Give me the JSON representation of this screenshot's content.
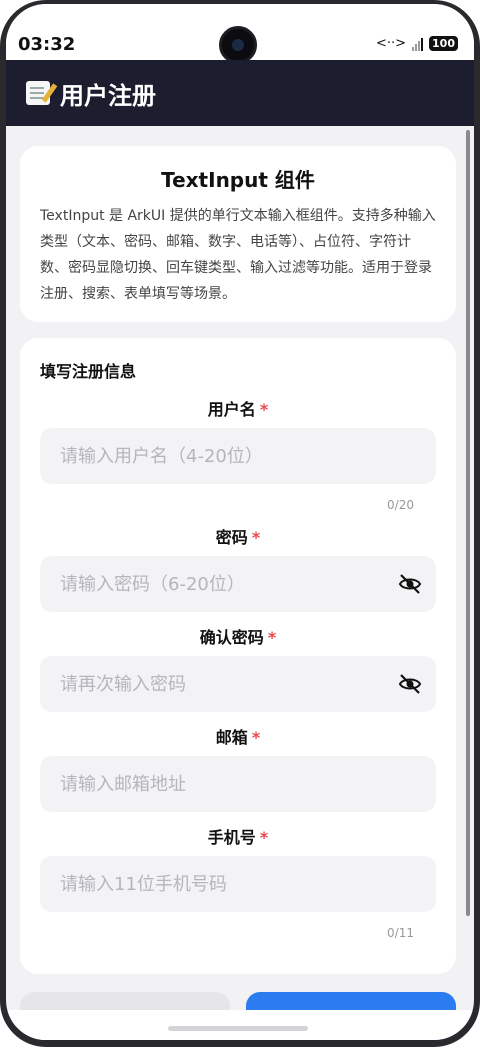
{
  "status_bar": {
    "time": "03:32",
    "battery": "100"
  },
  "header": {
    "icon": "memo-icon",
    "title": "用户注册"
  },
  "intro": {
    "title": "TextInput 组件",
    "description": "TextInput 是 ArkUI 提供的单行文本输入框组件。支持多种输入类型（文本、密码、邮箱、数字、电话等）、占位符、字符计数、密码显隐切换、回车键类型、输入过滤等功能。适用于登录注册、搜索、表单填写等场景。"
  },
  "form": {
    "heading": "填写注册信息",
    "required_mark": "*",
    "fields": {
      "username": {
        "label": "用户名",
        "placeholder": "请输入用户名（4-20位）",
        "counter": "0/20"
      },
      "password": {
        "label": "密码",
        "placeholder": "请输入密码（6-20位）"
      },
      "confirm_password": {
        "label": "确认密码",
        "placeholder": "请再次输入密码"
      },
      "email": {
        "label": "邮箱",
        "placeholder": "请输入邮箱地址"
      },
      "phone": {
        "label": "手机号",
        "placeholder": "请输入11位手机号码",
        "counter": "0/11"
      }
    }
  },
  "colors": {
    "header_bg": "#1d1d30",
    "primary_button": "#2a7cf0",
    "required": "#e5484d"
  }
}
